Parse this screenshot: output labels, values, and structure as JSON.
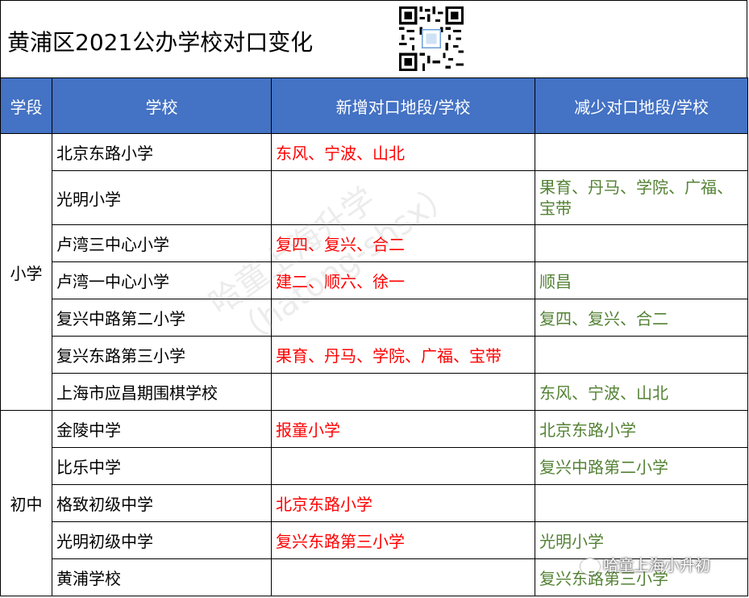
{
  "title": "黄浦区2021公办学校对口变化",
  "headers": [
    "学段",
    "学校",
    "新增对口地段/学校",
    "减少对口地段/学校"
  ],
  "primary": {
    "stage": "小学",
    "rows": [
      {
        "school": "北京东路小学",
        "added": "东风、宁波、山北",
        "removed": ""
      },
      {
        "school": "光明小学",
        "added": "",
        "removed": "果育、丹马、学院、广福、宝带"
      },
      {
        "school": "卢湾三中心小学",
        "added": "复四、复兴、合二",
        "removed": ""
      },
      {
        "school": "卢湾一中心小学",
        "added": "建二、顺六、徐一",
        "removed": "顺昌"
      },
      {
        "school": "复兴中路第二小学",
        "added": "",
        "removed": "复四、复兴、合二"
      },
      {
        "school": "复兴东路第三小学",
        "added": "果育、丹马、学院、广福、宝带",
        "removed": ""
      },
      {
        "school": "上海市应昌期围棋学校",
        "added": "",
        "removed": "东风、宁波、山北"
      }
    ]
  },
  "middle": {
    "stage": "初中",
    "rows": [
      {
        "school": "金陵中学",
        "added": "报童小学",
        "removed": "北京东路小学"
      },
      {
        "school": "比乐中学",
        "added": "",
        "removed": "复兴中路第二小学"
      },
      {
        "school": "格致初级中学",
        "added": "北京东路小学",
        "removed": ""
      },
      {
        "school": "光明初级中学",
        "added": "复兴东路第三小学",
        "removed": "光明小学"
      },
      {
        "school": "黄浦学校",
        "added": "",
        "removed": "复兴东路第三小学"
      }
    ]
  },
  "watermark": {
    "line1": "哈童上海升学",
    "line2": "（hatong-shsx）",
    "badge": "哈童上海小升初"
  },
  "colors": {
    "header_bg": "#4472C4",
    "added_text": "#FF0000",
    "removed_text": "#548235"
  },
  "icons": {
    "qr": "qr-code-icon",
    "badge": "wechat-icon"
  }
}
